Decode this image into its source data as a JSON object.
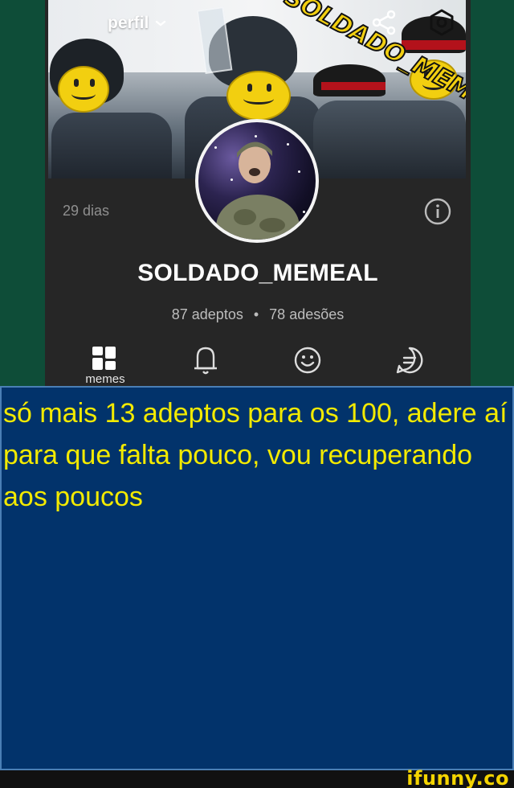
{
  "header": {
    "title": "perfil",
    "dropdown_icon": "chevron-down-icon",
    "share_icon": "share-icon",
    "settings_icon": "settings-icon"
  },
  "banner": {
    "image": "banner-image"
  },
  "profile": {
    "age": "29 dias",
    "username": "SOLDADO_MEMEAL",
    "followers": "87 adeptos",
    "separator": "•",
    "subscriptions": "78 adesões",
    "info_icon": "info-icon"
  },
  "tabs": [
    {
      "label": "memes",
      "icon": "grid-icon"
    },
    {
      "label": "",
      "icon": "bell-icon"
    },
    {
      "label": "",
      "icon": "smiley-icon"
    },
    {
      "label": "",
      "icon": "chat-icon"
    }
  ],
  "caption": {
    "text": "só mais 13 adeptos para os 100, adere aí para que falta pouco, vou recuperando aos poucos"
  },
  "watermark": {
    "text": "ifunny.co"
  },
  "colors": {
    "caption_text": "#f3ea00",
    "caption_bg": "#02336b",
    "panel_bg": "#262626",
    "side_bg": "#0e4d38"
  }
}
